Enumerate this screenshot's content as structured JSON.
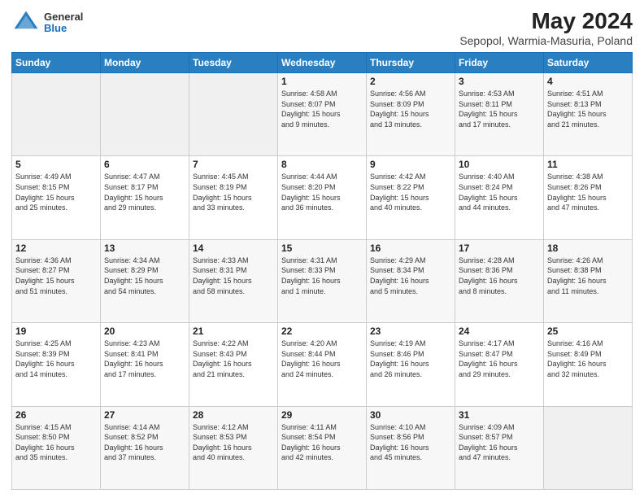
{
  "header": {
    "logo": {
      "general": "General",
      "blue": "Blue"
    },
    "title": "May 2024",
    "subtitle": "Sepopol, Warmia-Masuria, Poland"
  },
  "days_of_week": [
    "Sunday",
    "Monday",
    "Tuesday",
    "Wednesday",
    "Thursday",
    "Friday",
    "Saturday"
  ],
  "weeks": [
    [
      {
        "day": "",
        "info": ""
      },
      {
        "day": "",
        "info": ""
      },
      {
        "day": "",
        "info": ""
      },
      {
        "day": "1",
        "info": "Sunrise: 4:58 AM\nSunset: 8:07 PM\nDaylight: 15 hours\nand 9 minutes."
      },
      {
        "day": "2",
        "info": "Sunrise: 4:56 AM\nSunset: 8:09 PM\nDaylight: 15 hours\nand 13 minutes."
      },
      {
        "day": "3",
        "info": "Sunrise: 4:53 AM\nSunset: 8:11 PM\nDaylight: 15 hours\nand 17 minutes."
      },
      {
        "day": "4",
        "info": "Sunrise: 4:51 AM\nSunset: 8:13 PM\nDaylight: 15 hours\nand 21 minutes."
      }
    ],
    [
      {
        "day": "5",
        "info": "Sunrise: 4:49 AM\nSunset: 8:15 PM\nDaylight: 15 hours\nand 25 minutes."
      },
      {
        "day": "6",
        "info": "Sunrise: 4:47 AM\nSunset: 8:17 PM\nDaylight: 15 hours\nand 29 minutes."
      },
      {
        "day": "7",
        "info": "Sunrise: 4:45 AM\nSunset: 8:19 PM\nDaylight: 15 hours\nand 33 minutes."
      },
      {
        "day": "8",
        "info": "Sunrise: 4:44 AM\nSunset: 8:20 PM\nDaylight: 15 hours\nand 36 minutes."
      },
      {
        "day": "9",
        "info": "Sunrise: 4:42 AM\nSunset: 8:22 PM\nDaylight: 15 hours\nand 40 minutes."
      },
      {
        "day": "10",
        "info": "Sunrise: 4:40 AM\nSunset: 8:24 PM\nDaylight: 15 hours\nand 44 minutes."
      },
      {
        "day": "11",
        "info": "Sunrise: 4:38 AM\nSunset: 8:26 PM\nDaylight: 15 hours\nand 47 minutes."
      }
    ],
    [
      {
        "day": "12",
        "info": "Sunrise: 4:36 AM\nSunset: 8:27 PM\nDaylight: 15 hours\nand 51 minutes."
      },
      {
        "day": "13",
        "info": "Sunrise: 4:34 AM\nSunset: 8:29 PM\nDaylight: 15 hours\nand 54 minutes."
      },
      {
        "day": "14",
        "info": "Sunrise: 4:33 AM\nSunset: 8:31 PM\nDaylight: 15 hours\nand 58 minutes."
      },
      {
        "day": "15",
        "info": "Sunrise: 4:31 AM\nSunset: 8:33 PM\nDaylight: 16 hours\nand 1 minute."
      },
      {
        "day": "16",
        "info": "Sunrise: 4:29 AM\nSunset: 8:34 PM\nDaylight: 16 hours\nand 5 minutes."
      },
      {
        "day": "17",
        "info": "Sunrise: 4:28 AM\nSunset: 8:36 PM\nDaylight: 16 hours\nand 8 minutes."
      },
      {
        "day": "18",
        "info": "Sunrise: 4:26 AM\nSunset: 8:38 PM\nDaylight: 16 hours\nand 11 minutes."
      }
    ],
    [
      {
        "day": "19",
        "info": "Sunrise: 4:25 AM\nSunset: 8:39 PM\nDaylight: 16 hours\nand 14 minutes."
      },
      {
        "day": "20",
        "info": "Sunrise: 4:23 AM\nSunset: 8:41 PM\nDaylight: 16 hours\nand 17 minutes."
      },
      {
        "day": "21",
        "info": "Sunrise: 4:22 AM\nSunset: 8:43 PM\nDaylight: 16 hours\nand 21 minutes."
      },
      {
        "day": "22",
        "info": "Sunrise: 4:20 AM\nSunset: 8:44 PM\nDaylight: 16 hours\nand 24 minutes."
      },
      {
        "day": "23",
        "info": "Sunrise: 4:19 AM\nSunset: 8:46 PM\nDaylight: 16 hours\nand 26 minutes."
      },
      {
        "day": "24",
        "info": "Sunrise: 4:17 AM\nSunset: 8:47 PM\nDaylight: 16 hours\nand 29 minutes."
      },
      {
        "day": "25",
        "info": "Sunrise: 4:16 AM\nSunset: 8:49 PM\nDaylight: 16 hours\nand 32 minutes."
      }
    ],
    [
      {
        "day": "26",
        "info": "Sunrise: 4:15 AM\nSunset: 8:50 PM\nDaylight: 16 hours\nand 35 minutes."
      },
      {
        "day": "27",
        "info": "Sunrise: 4:14 AM\nSunset: 8:52 PM\nDaylight: 16 hours\nand 37 minutes."
      },
      {
        "day": "28",
        "info": "Sunrise: 4:12 AM\nSunset: 8:53 PM\nDaylight: 16 hours\nand 40 minutes."
      },
      {
        "day": "29",
        "info": "Sunrise: 4:11 AM\nSunset: 8:54 PM\nDaylight: 16 hours\nand 42 minutes."
      },
      {
        "day": "30",
        "info": "Sunrise: 4:10 AM\nSunset: 8:56 PM\nDaylight: 16 hours\nand 45 minutes."
      },
      {
        "day": "31",
        "info": "Sunrise: 4:09 AM\nSunset: 8:57 PM\nDaylight: 16 hours\nand 47 minutes."
      },
      {
        "day": "",
        "info": ""
      }
    ]
  ]
}
